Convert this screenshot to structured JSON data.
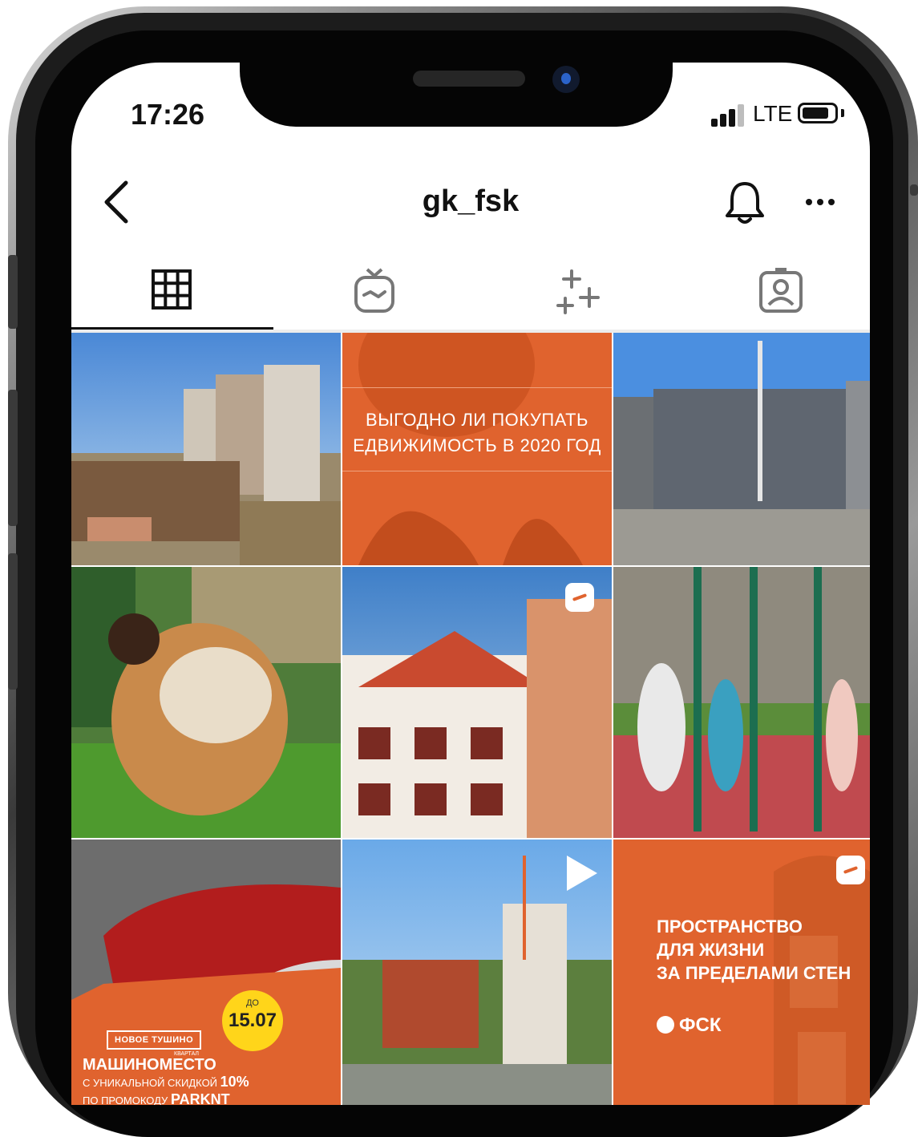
{
  "status_bar": {
    "time": "17:26",
    "network": "LTE"
  },
  "nav": {
    "title": "gk_fsk"
  },
  "tabs": [
    {
      "name": "grid",
      "icon": "grid-icon",
      "active": true
    },
    {
      "name": "igtv",
      "icon": "igtv-icon",
      "active": false
    },
    {
      "name": "guides",
      "icon": "sparkles-icon",
      "active": false
    },
    {
      "name": "tagged",
      "icon": "tagged-user-icon",
      "active": false
    }
  ],
  "posts": [
    {
      "id": 1,
      "kind": "photo"
    },
    {
      "id": 2,
      "kind": "photo",
      "line1": "ВЫГОДНО ЛИ ПОКУПАТЬ",
      "line2": "ЕДВИЖИМОСТЬ В 2020 ГОД"
    },
    {
      "id": 3,
      "kind": "photo"
    },
    {
      "id": 4,
      "kind": "photo"
    },
    {
      "id": 5,
      "kind": "igtv"
    },
    {
      "id": 6,
      "kind": "photo"
    },
    {
      "id": 7,
      "kind": "photo",
      "tag": "НОВОЕ ТУШИНО",
      "tag_sub": "КВАРТАЛ",
      "circle_small": "ДО",
      "circle_big": "15.07",
      "main": "МАШИНОМЕСТО",
      "line2": "С УНИКАЛЬНОЙ СКИДКОЙ",
      "line2_bold": "10%",
      "line3": "ПО ПРОМОКОДУ",
      "line3_bold": "PARKNT"
    },
    {
      "id": 8,
      "kind": "video"
    },
    {
      "id": 9,
      "kind": "igtv",
      "line1": "ПРОСТРАНСТВО",
      "line2": "ДЛЯ ЖИЗНИ",
      "line3": "ЗА ПРЕДЕЛАМИ СТЕН",
      "logo": "ФСК"
    }
  ],
  "colors": {
    "accent_orange": "#e0632e",
    "promo_yellow": "#ffd51a",
    "text": "#111111"
  }
}
